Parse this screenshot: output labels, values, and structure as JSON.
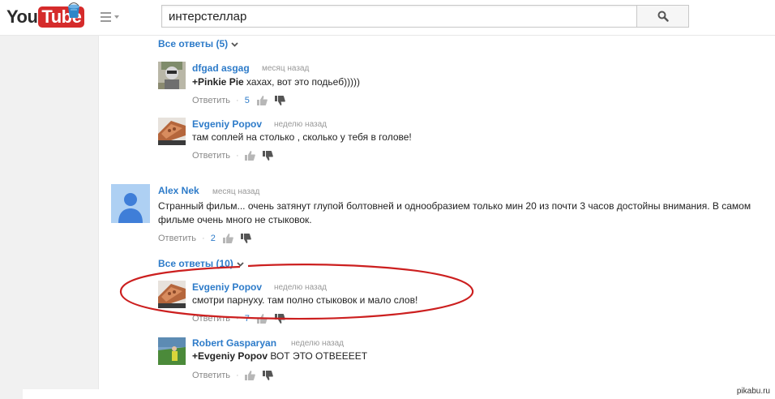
{
  "header": {
    "logo_you": "You",
    "logo_tube": "Tube",
    "search_value": "интерстеллар"
  },
  "thread1": {
    "more_label": "Все ответы (5)",
    "replies": [
      {
        "author": "dfgad asgag",
        "time": "месяц назад",
        "mention": "+Pinkie Pie",
        "text": " хахах, вот это подьеб)))))",
        "reply_label": "Ответить",
        "likes": "5"
      },
      {
        "author": "Evgeniy Popov",
        "time": "неделю назад",
        "text": "там соплей на столько , сколько у тебя в голове!",
        "reply_label": "Ответить"
      }
    ]
  },
  "main_comment": {
    "author": "Alex Nek",
    "time": "месяц назад",
    "text": "Странный фильм... очень затянут глупой болтовней и однообразием только  мин 20 из почти 3 часов достойны внимания. В самом фильме очень много не стыковок.",
    "reply_label": "Ответить",
    "likes": "2"
  },
  "thread2": {
    "more_label": "Все ответы (10)",
    "replies": [
      {
        "author": "Evgeniy Popov",
        "time": "неделю назад",
        "text": "смотри парнуху. там полно стыковок и мало слов!",
        "reply_label": "Ответить",
        "likes": "7"
      },
      {
        "author": "Robert Gasparyan",
        "time": "неделю назад",
        "mention": "+Evgeniy Popov",
        "text": " ВОТ ЭТО ОТВЕЕЕЕТ",
        "reply_label": "Ответить"
      }
    ]
  },
  "icons": [
    "bucket-icon",
    "menu-icon",
    "search-icon",
    "chevron-down-icon",
    "thumbs-up-icon",
    "thumbs-down-icon",
    "default-avatar-icon"
  ],
  "colors": {
    "link": "#2d7bc9",
    "brand_red": "#d52b2b",
    "annotation": "#cc1f1f"
  },
  "watermark": "pikabu.ru"
}
